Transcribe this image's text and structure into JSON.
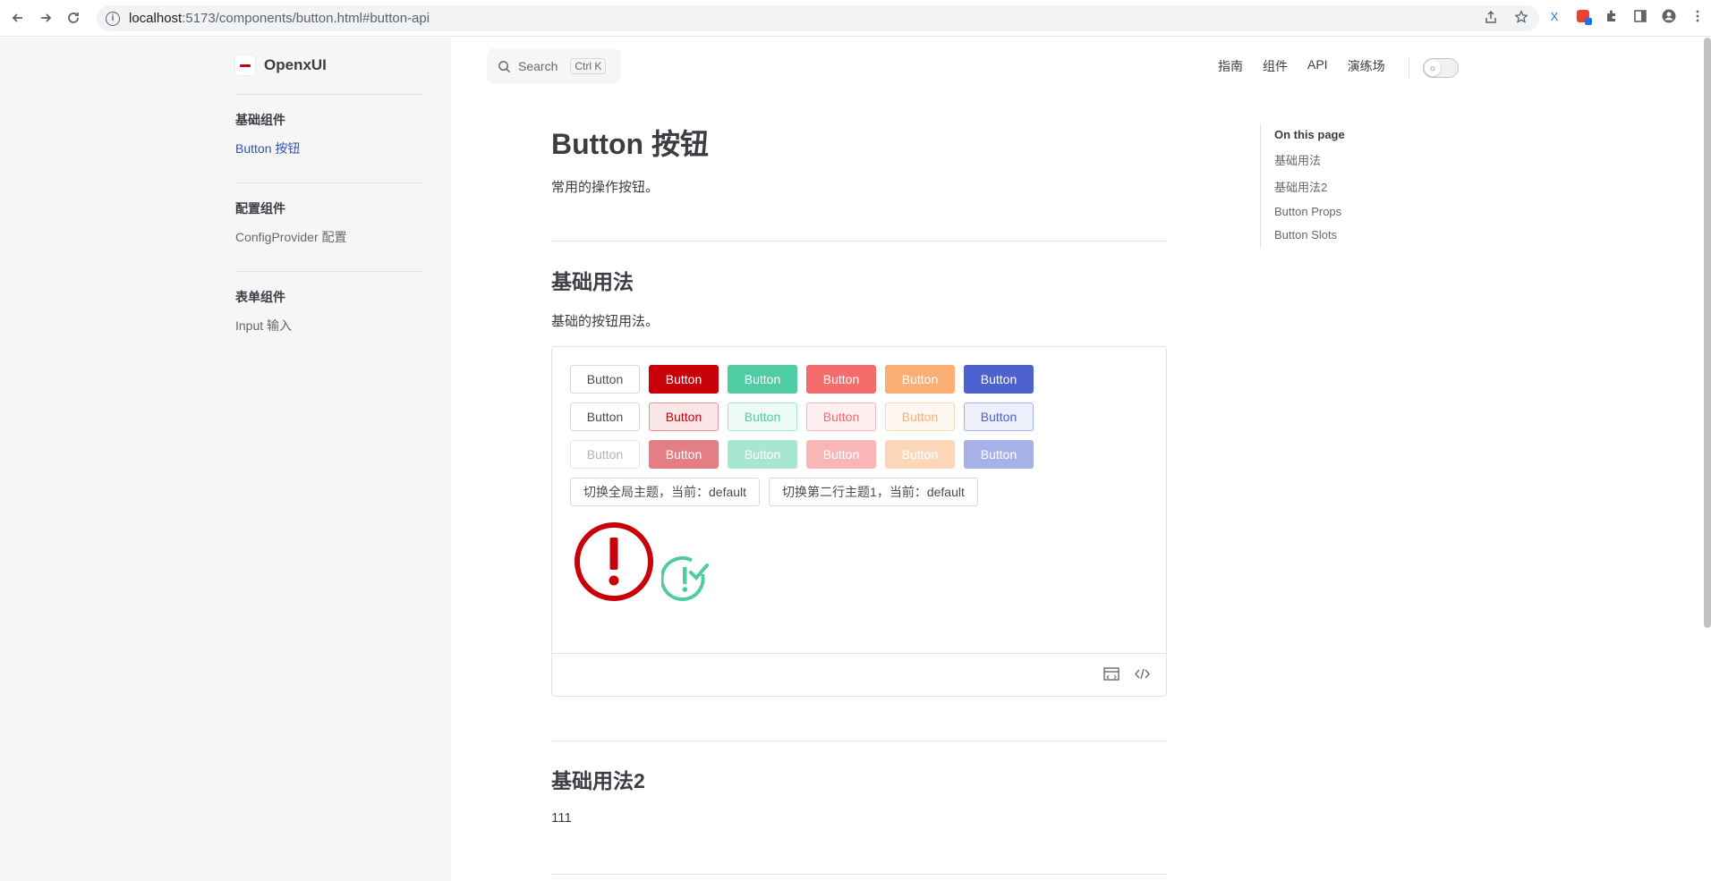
{
  "browser": {
    "url_host": "localhost",
    "url_path": ":5173/components/button.html#button-api"
  },
  "brand": {
    "name": "OpenxUI"
  },
  "sidebar": {
    "groups": [
      {
        "title": "基础组件",
        "items": [
          {
            "label": "Button 按钮",
            "active": true
          }
        ]
      },
      {
        "title": "配置组件",
        "items": [
          {
            "label": "ConfigProvider 配置"
          }
        ]
      },
      {
        "title": "表单组件",
        "items": [
          {
            "label": "Input 输入"
          }
        ]
      }
    ]
  },
  "search": {
    "label": "Search",
    "shortcut": "Ctrl K"
  },
  "nav": {
    "items": [
      "指南",
      "组件",
      "API",
      "演练场"
    ]
  },
  "content": {
    "title": "Button 按钮",
    "lead": "常用的操作按钮。",
    "section1": {
      "title": "基础用法",
      "desc": "基础的按钮用法。"
    },
    "section2": {
      "title": "基础用法2",
      "desc": "111"
    },
    "button_label": "Button",
    "toggle_global": "切换全局主题，当前：default",
    "toggle_row2": "切换第二行主题1，当前：default"
  },
  "buttons": {
    "row1": [
      {
        "bg": "#ffffff",
        "border": "#d9d9d9",
        "color": "#4c4c4c"
      },
      {
        "bg": "#c8000a",
        "border": "#c8000a",
        "color": "#ffffff"
      },
      {
        "bg": "#4ecca3",
        "border": "#4ecca3",
        "color": "#ffffff"
      },
      {
        "bg": "#f56c6c",
        "border": "#f56c6c",
        "color": "#ffffff"
      },
      {
        "bg": "#fbaf74",
        "border": "#fbaf74",
        "color": "#ffffff"
      },
      {
        "bg": "#4d62d0",
        "border": "#4d62d0",
        "color": "#ffffff"
      }
    ],
    "row2": [
      {
        "bg": "#ffffff",
        "border": "#d9d9d9",
        "color": "#4c4c4c"
      },
      {
        "bg": "#fbe6e7",
        "border": "#e89498",
        "color": "#c8000a"
      },
      {
        "bg": "#edfaf6",
        "border": "#a7e6d1",
        "color": "#4ecca3"
      },
      {
        "bg": "#fef0f0",
        "border": "#fab6b6",
        "color": "#f56c6c"
      },
      {
        "bg": "#fff7f1",
        "border": "#fdd7ba",
        "color": "#fbaf74"
      },
      {
        "bg": "#edeffa",
        "border": "#a6b1e8",
        "color": "#4d62d0"
      }
    ],
    "row3": [
      {
        "bg": "#ffffff",
        "border": "#e4e4e4",
        "color": "#b4b4b4"
      },
      {
        "bg": "#e37f84",
        "border": "#e37f84",
        "color": "#ffffff"
      },
      {
        "bg": "#a7e6d1",
        "border": "#a7e6d1",
        "color": "#ffffff"
      },
      {
        "bg": "#fab6b6",
        "border": "#fab6b6",
        "color": "#ffffff"
      },
      {
        "bg": "#fdd7ba",
        "border": "#fdd7ba",
        "color": "#ffffff"
      },
      {
        "bg": "#a6b1e8",
        "border": "#a6b1e8",
        "color": "#ffffff"
      }
    ]
  },
  "icons": {
    "warning": "warning-circle-icon",
    "success": "check-circle-icon",
    "warning_color": "#c8000a",
    "success_color": "#4ecca3"
  },
  "toc": {
    "title": "On this page",
    "items": [
      "基础用法",
      "基础用法2",
      "Button Props",
      "Button Slots"
    ]
  }
}
